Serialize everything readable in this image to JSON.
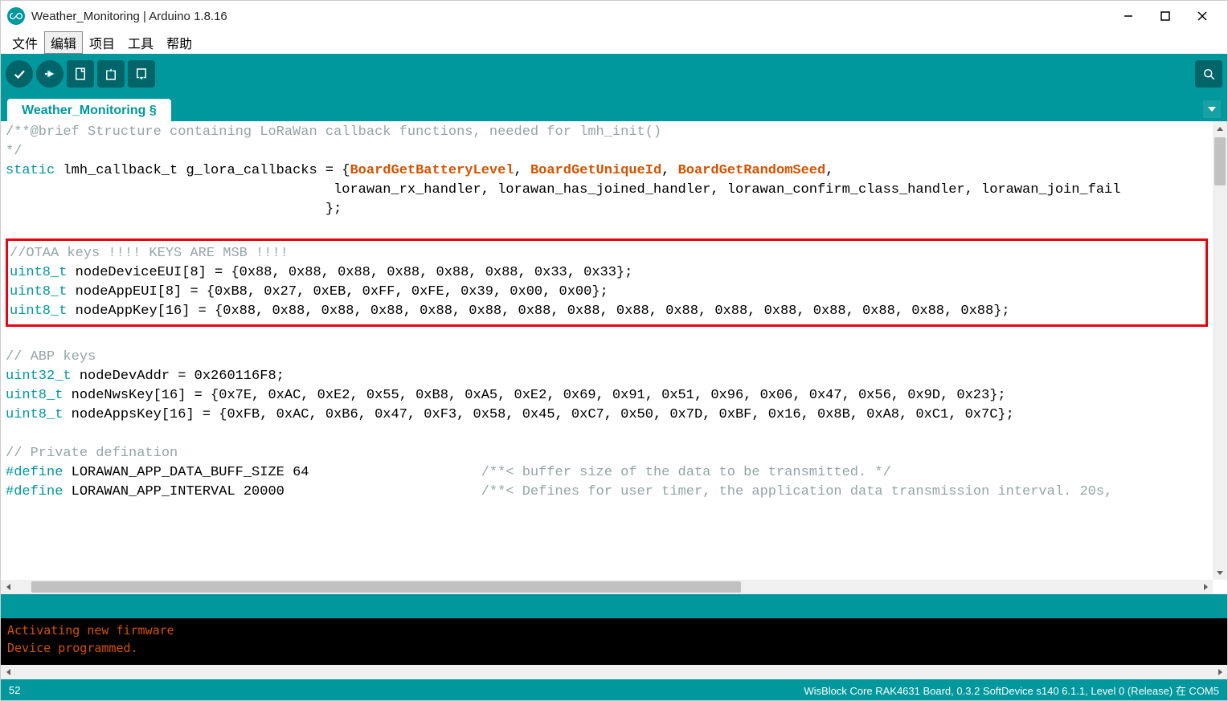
{
  "titlebar": {
    "title": "Weather_Monitoring | Arduino 1.8.16"
  },
  "menu": {
    "file": "文件",
    "edit": "编辑",
    "project": "项目",
    "tools": "工具",
    "help": "帮助"
  },
  "tab": {
    "name": "Weather_Monitoring §"
  },
  "code": {
    "line1_comment": "/**@brief Structure containing LoRaWan callback functions, needed for lmh_init()",
    "line2_comment": "*/",
    "line3_kw": "static",
    "line3_rest": " lmh_callback_t g_lora_callbacks = {",
    "line3_f1": "BoardGetBatteryLevel",
    "line3_c1": ", ",
    "line3_f2": "BoardGetUniqueId",
    "line3_c2": ", ",
    "line3_f3": "BoardGetRandomSeed",
    "line3_c3": ",",
    "line4": "                                        lorawan_rx_handler, lorawan_has_joined_handler, lorawan_confirm_class_handler, lorawan_join_fail",
    "line5": "                                       };",
    "otaa_comment": "//OTAA keys !!!! KEYS ARE MSB !!!!",
    "otaa_t1": "uint8_t",
    "otaa_l1": " nodeDeviceEUI[8] = {0x88, 0x88, 0x88, 0x88, 0x88, 0x88, 0x33, 0x33};",
    "otaa_t2": "uint8_t",
    "otaa_l2": " nodeAppEUI[8] = {0xB8, 0x27, 0xEB, 0xFF, 0xFE, 0x39, 0x00, 0x00};",
    "otaa_t3": "uint8_t",
    "otaa_l3": " nodeAppKey[16] = {0x88, 0x88, 0x88, 0x88, 0x88, 0x88, 0x88, 0x88, 0x88, 0x88, 0x88, 0x88, 0x88, 0x88, 0x88, 0x88};",
    "abp_comment": "// ABP keys",
    "abp_t1": "uint32_t",
    "abp_l1": " nodeDevAddr = 0x260116F8;",
    "abp_t2": "uint8_t",
    "abp_l2": " nodeNwsKey[16] = {0x7E, 0xAC, 0xE2, 0x55, 0xB8, 0xA5, 0xE2, 0x69, 0x91, 0x51, 0x96, 0x06, 0x47, 0x56, 0x9D, 0x23};",
    "abp_t3": "uint8_t",
    "abp_l3": " nodeAppsKey[16] = {0xFB, 0xAC, 0xB6, 0x47, 0xF3, 0x58, 0x45, 0xC7, 0x50, 0x7D, 0xBF, 0x16, 0x8B, 0xA8, 0xC1, 0x7C};",
    "priv_comment": "// Private defination",
    "def1_kw": "#define",
    "def1_rest": " LORAWAN_APP_DATA_BUFF_SIZE 64                     ",
    "def1_cm": "/**< buffer size of the data to be transmitted. */",
    "def2_kw": "#define",
    "def2_rest": " LORAWAN_APP_INTERVAL 20000                        ",
    "def2_cm": "/**< Defines for user timer, the application data transmission interval. 20s, "
  },
  "console": {
    "line1": "Activating new firmware",
    "line2": "Device programmed."
  },
  "footer": {
    "left": "52",
    "right": "WisBlock Core RAK4631 Board, 0.3.2 SoftDevice s140 6.1.1, Level 0 (Release) 在 COM5"
  }
}
